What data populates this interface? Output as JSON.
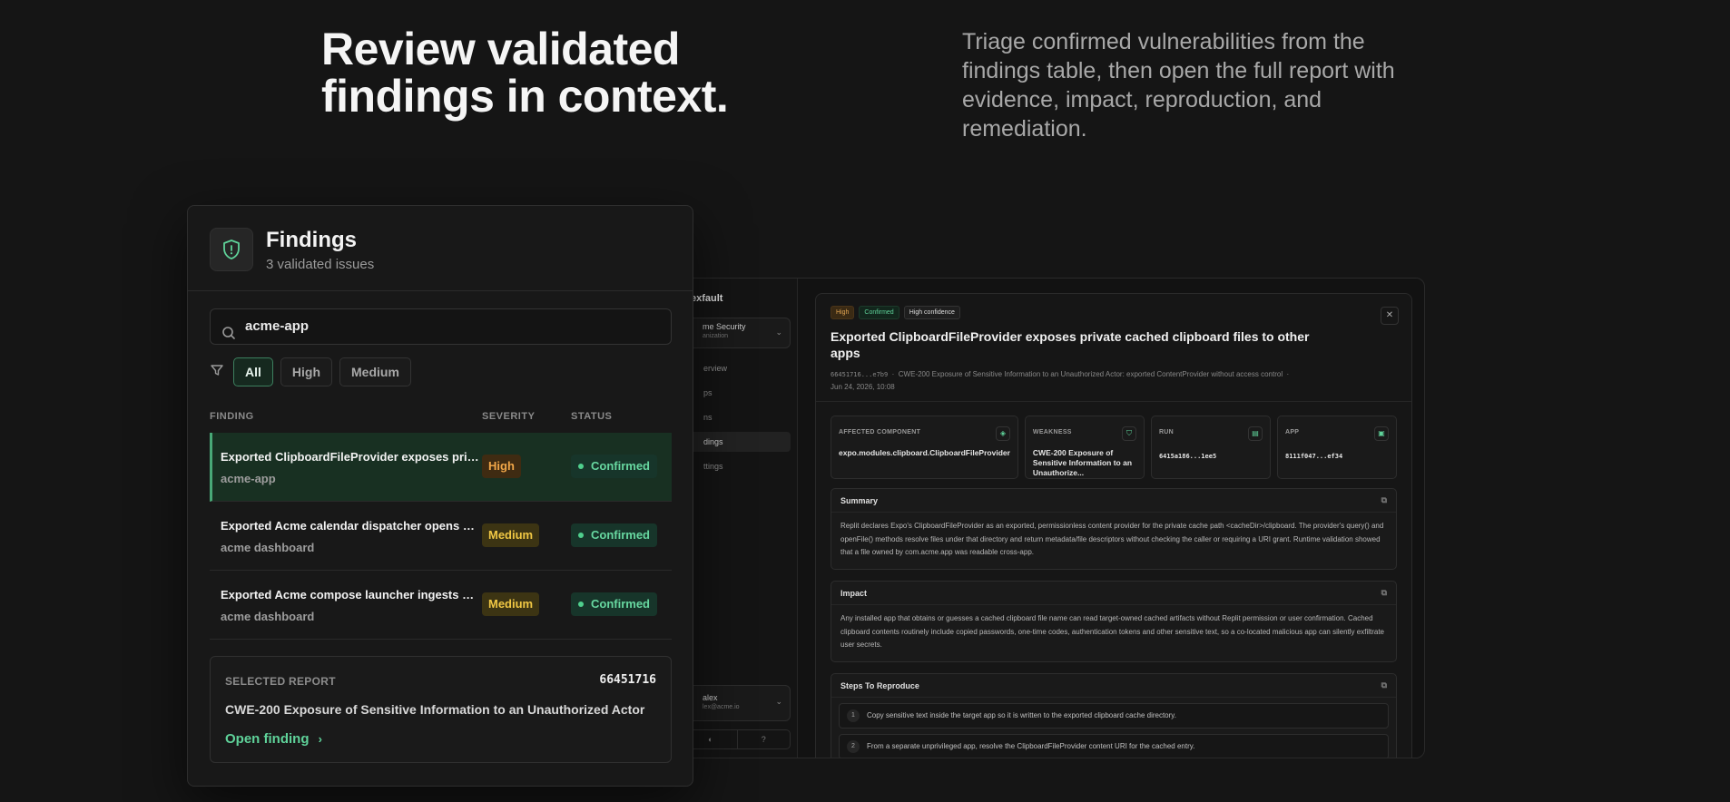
{
  "hero": {
    "title": "Review validated findings in context.",
    "description": "Triage confirmed vulnerabilities from the findings table, then open the full report with evidence, impact, reproduction, and remediation."
  },
  "app": {
    "org": "exfault",
    "workspace_name": "me Security",
    "workspace_sub": "anization",
    "nav": [
      "erview",
      "ps",
      "ns",
      "dings",
      "ttings"
    ],
    "user_name": "alex",
    "user_email": "lex@acme.io"
  },
  "report": {
    "tags": [
      "High",
      "Confirmed",
      "High confidence"
    ],
    "close_icon": "close-icon",
    "title": "Exported ClipboardFileProvider exposes private cached clipboard files to other apps",
    "meta_id": "66451716...e7b9",
    "meta_cwe": "CWE-200 Exposure of Sensitive Information to an Unauthorized Actor: exported ContentProvider without access control",
    "meta_date": "Jun 24, 2026, 10:08",
    "cards": [
      {
        "label": "AFFECTED COMPONENT",
        "value": "expo.modules.clipboard.ClipboardFileProvider",
        "icon": "component-icon"
      },
      {
        "label": "WEAKNESS",
        "value": "CWE-200 Exposure of Sensitive Information to an Unauthorize...",
        "icon": "shield-icon"
      },
      {
        "label": "RUN",
        "value": "6415a186...1ee5",
        "icon": "clipboard-icon"
      },
      {
        "label": "APP",
        "value": "8111f047...ef34",
        "icon": "app-icon"
      }
    ],
    "summary_title": "Summary",
    "summary_body": "Replit declares Expo's ClipboardFileProvider as an exported, permissionless content provider for the private cache path <cacheDir>/clipboard. The provider's query() and openFile() methods resolve files under that directory and return metadata/file descriptors without checking the caller or requiring a URI grant. Runtime validation showed that a file owned by com.acme.app was readable cross-app.",
    "impact_title": "Impact",
    "impact_body": "Any installed app that obtains or guesses a cached clipboard file name can read target-owned cached artifacts without Replit permission or user confirmation. Cached clipboard contents routinely include copied passwords, one-time codes, authentication tokens and other sensitive text, so a co-located malicious app can silently exfiltrate user secrets.",
    "steps_title": "Steps To Reproduce",
    "steps": [
      {
        "n": "1",
        "text": "Copy sensitive text inside the target app so it is written to the exported clipboard cache directory."
      },
      {
        "n": "2",
        "text": "From a separate unprivileged app, resolve the ClipboardFileProvider content URI for the cached entry."
      }
    ]
  },
  "findings": {
    "title": "Findings",
    "subtitle": "3 validated issues",
    "search_value": "acme-app",
    "filters": [
      "All",
      "High",
      "Medium"
    ],
    "columns": [
      "FINDING",
      "SEVERITY",
      "STATUS"
    ],
    "rows": [
      {
        "name": "Exported ClipboardFileProvider exposes private cached clipboard files to other apps",
        "app": "acme-app",
        "severity": "High",
        "status": "Confirmed"
      },
      {
        "name": "Exported Acme calendar dispatcher opens arbitrary intents",
        "app": "acme dashboard",
        "severity": "Medium",
        "status": "Confirmed"
      },
      {
        "name": "Exported Acme compose launcher ingests untrusted extras",
        "app": "acme dashboard",
        "severity": "Medium",
        "status": "Confirmed"
      }
    ],
    "selected_report": {
      "label": "SELECTED REPORT",
      "id": "66451716",
      "cwe": "CWE-200 Exposure of Sensitive Information to an Unauthorized Actor",
      "open_label": "Open finding"
    }
  },
  "colors": {
    "accent_green": "#5fd39a",
    "high": "#f0a648",
    "medium": "#f0c744",
    "background": "#151515"
  }
}
